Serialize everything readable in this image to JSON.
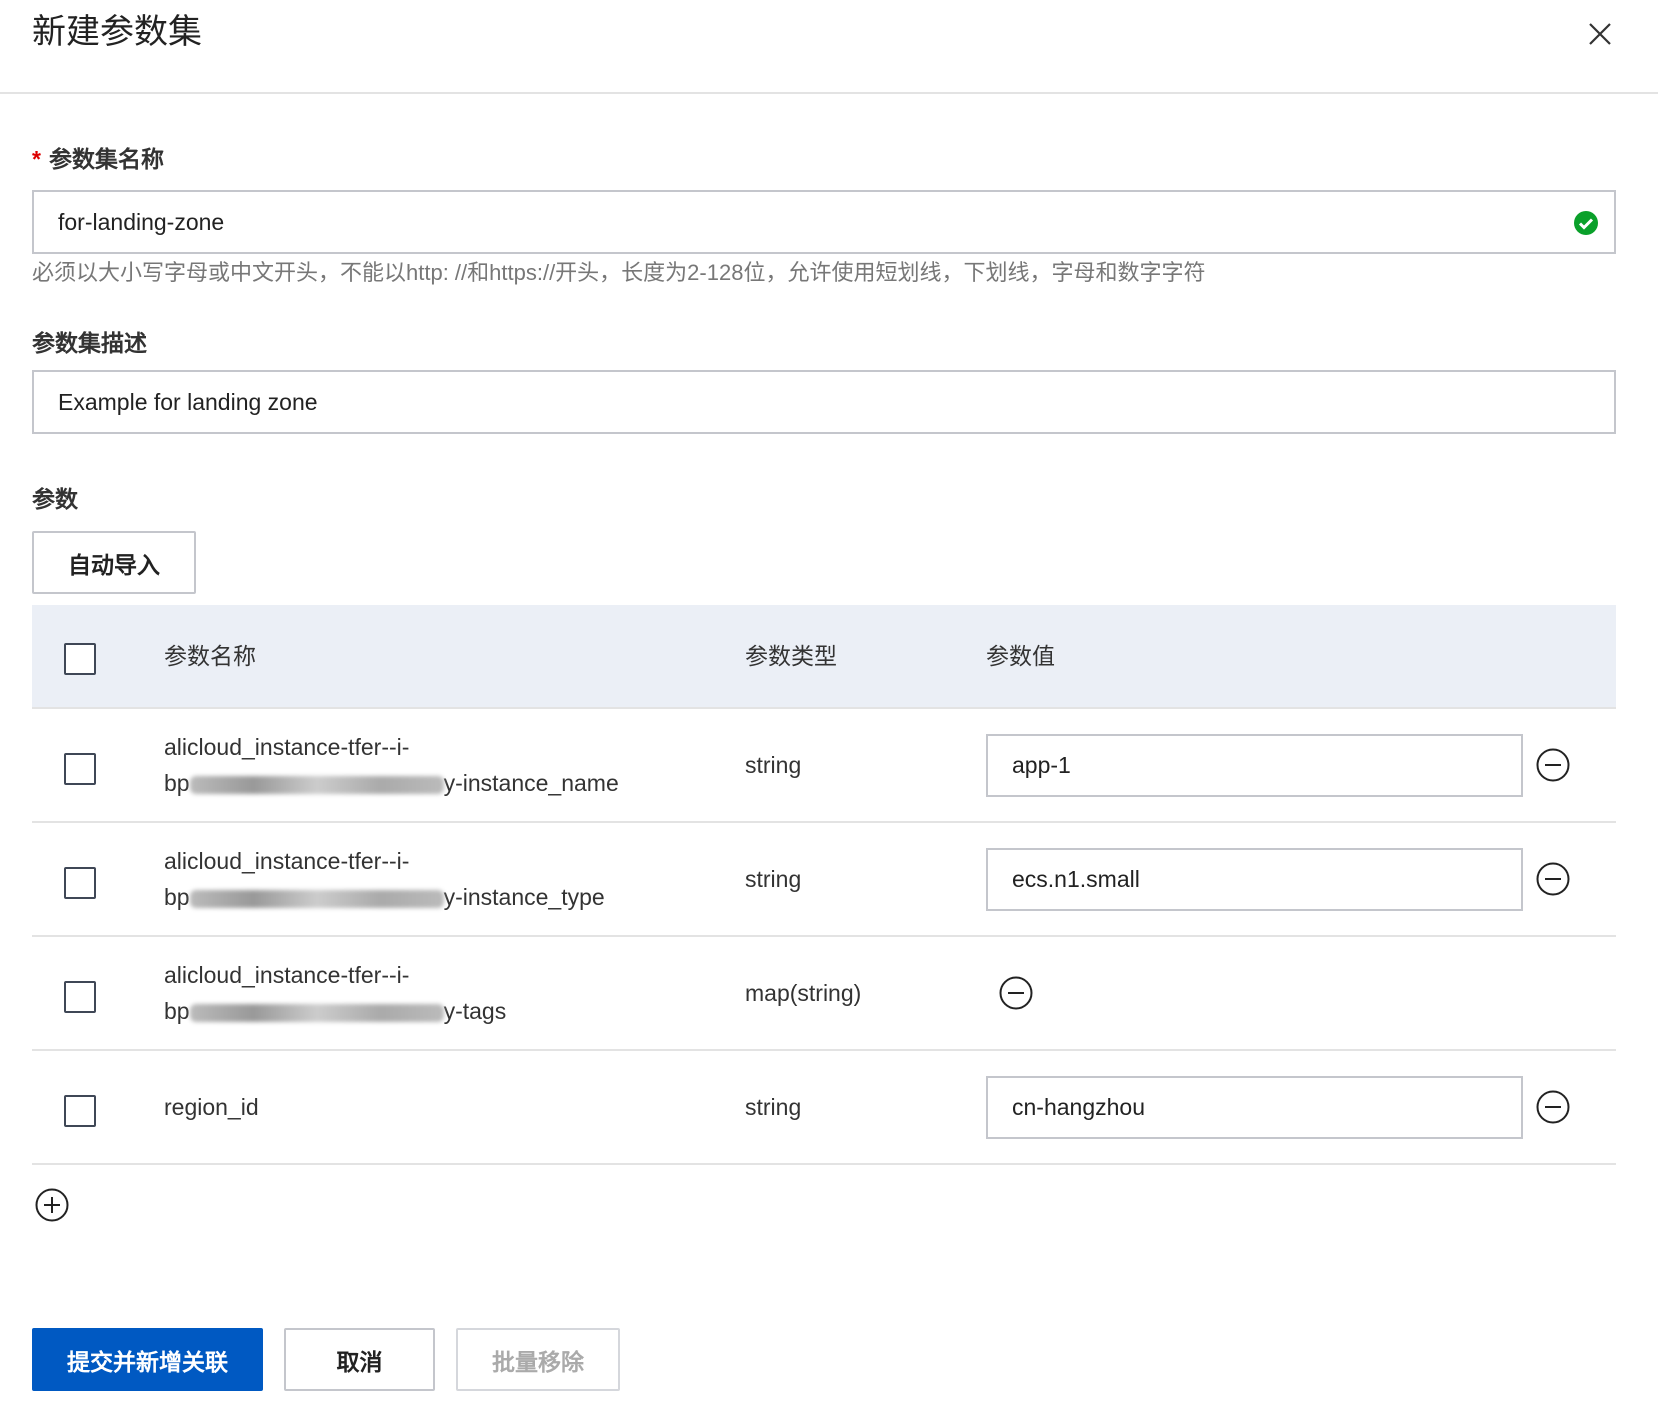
{
  "dialog": {
    "title": "新建参数集",
    "close_icon": "close-icon"
  },
  "form": {
    "name_label": "参数集名称",
    "required_mark": "*",
    "name_value": "for-landing-zone",
    "name_hint": "必须以大小写字母或中文开头，不能以http: //和https://开头，长度为2-128位，允许使用短划线，下划线，字母和数字字符",
    "desc_label": "参数集描述",
    "desc_value": "Example for landing zone",
    "params_label": "参数",
    "auto_import": "自动导入"
  },
  "table": {
    "headers": {
      "name": "参数名称",
      "type": "参数类型",
      "value": "参数值"
    },
    "rows": [
      {
        "name_line1": "alicloud_instance-tfer--i-",
        "name_prefix": "bp",
        "name_suffix": "y-instance_name",
        "type": "string",
        "value": "app-1"
      },
      {
        "name_line1": "alicloud_instance-tfer--i-",
        "name_prefix": "bp",
        "name_suffix": "y-instance_type",
        "type": "string",
        "value": "ecs.n1.small"
      },
      {
        "name_line1": "alicloud_instance-tfer--i-",
        "name_prefix": "bp",
        "name_suffix": "y-tags",
        "type": "map(string)",
        "value": null
      },
      {
        "name_line1": "region_id",
        "type": "string",
        "value": "cn-hangzhou"
      }
    ]
  },
  "footer": {
    "submit": "提交并新增关联",
    "cancel": "取消",
    "batch_remove": "批量移除"
  },
  "colors": {
    "primary": "#0059c2",
    "success": "#0aa02a",
    "required": "#d00000"
  }
}
